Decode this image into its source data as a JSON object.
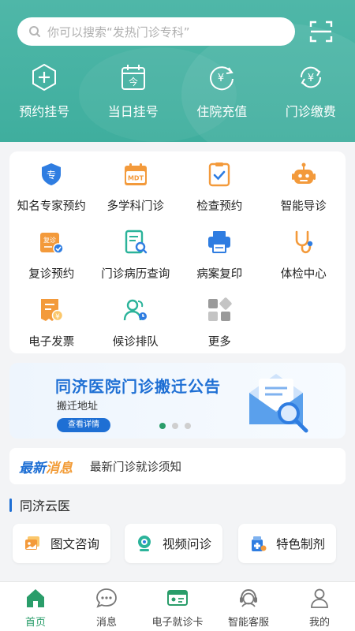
{
  "search": {
    "placeholder": "你可以搜索“发热门诊专科”"
  },
  "quick_actions": [
    {
      "label": "预约挂号",
      "icon": "plus-circle-icon"
    },
    {
      "label": "当日挂号",
      "icon": "calendar-today-icon"
    },
    {
      "label": "住院充值",
      "icon": "yuan-recharge-icon"
    },
    {
      "label": "门诊缴费",
      "icon": "yuan-refresh-icon"
    }
  ],
  "services": [
    {
      "label": "知名专家预约",
      "icon": "expert-shield-icon",
      "icon_text": "专"
    },
    {
      "label": "多学科门诊",
      "icon": "mdt-calendar-icon",
      "icon_text": "MDT"
    },
    {
      "label": "检查预约",
      "icon": "checklist-icon"
    },
    {
      "label": "智能导诊",
      "icon": "robot-icon"
    },
    {
      "label": "复诊预约",
      "icon": "revisit-calendar-icon",
      "icon_text": "复诊"
    },
    {
      "label": "门诊病历查询",
      "icon": "record-search-icon"
    },
    {
      "label": "病案复印",
      "icon": "printer-icon"
    },
    {
      "label": "体检中心",
      "icon": "stethoscope-icon"
    },
    {
      "label": "电子发票",
      "icon": "invoice-icon"
    },
    {
      "label": "候诊排队",
      "icon": "queue-people-icon"
    },
    {
      "label": "更多",
      "icon": "more-grid-icon"
    }
  ],
  "banner": {
    "title": "同济医院门诊搬迁公告",
    "subtitle": "搬迁地址",
    "button": "查看详情",
    "page_count": 3,
    "active_page": 1
  },
  "news": {
    "tag_prefix": "最新",
    "tag_suffix": "消息",
    "text": "最新门诊就诊须知"
  },
  "cloud": {
    "title": "同济云医",
    "items": [
      {
        "label": "图文咨询",
        "icon": "image-chat-icon"
      },
      {
        "label": "视频问诊",
        "icon": "webcam-icon"
      },
      {
        "label": "特色制剂",
        "icon": "medicine-icon"
      }
    ]
  },
  "tabbar": [
    {
      "label": "首页",
      "icon": "home-icon",
      "active": true
    },
    {
      "label": "消息",
      "icon": "message-icon",
      "active": false
    },
    {
      "label": "电子就诊卡",
      "icon": "card-icon",
      "active": false
    },
    {
      "label": "智能客服",
      "icon": "customer-service-icon",
      "active": false
    },
    {
      "label": "我的",
      "icon": "user-icon",
      "active": false
    }
  ],
  "colors": {
    "header": "#3fae9e",
    "primary_blue": "#1e6fd4",
    "orange": "#f29c38",
    "active_green": "#2a9d6a"
  }
}
